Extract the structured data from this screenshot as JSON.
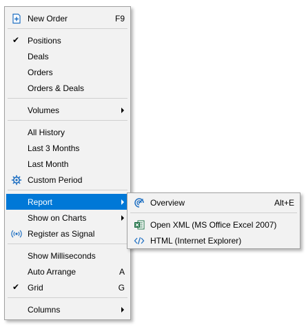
{
  "main_menu": {
    "new_order": {
      "label": "New Order",
      "shortcut": "F9",
      "icon": "new-order-icon"
    },
    "positions": {
      "label": "Positions",
      "checked": true
    },
    "deals": {
      "label": "Deals"
    },
    "orders": {
      "label": "Orders"
    },
    "orders_deals": {
      "label": "Orders & Deals"
    },
    "volumes": {
      "label": "Volumes",
      "submenu": true
    },
    "all_history": {
      "label": "All History"
    },
    "last_3_months": {
      "label": "Last 3 Months"
    },
    "last_month": {
      "label": "Last Month"
    },
    "custom_period": {
      "label": "Custom Period",
      "icon": "gear-icon"
    },
    "report": {
      "label": "Report",
      "submenu": true,
      "highlighted": true
    },
    "show_on_charts": {
      "label": "Show on Charts",
      "submenu": true
    },
    "register_signal": {
      "label": "Register as Signal",
      "icon": "signal-icon"
    },
    "show_milliseconds": {
      "label": "Show Milliseconds"
    },
    "auto_arrange": {
      "label": "Auto Arrange",
      "shortcut": "A"
    },
    "grid": {
      "label": "Grid",
      "shortcut": "G",
      "checked": true
    },
    "columns": {
      "label": "Columns",
      "submenu": true
    }
  },
  "report_submenu": {
    "overview": {
      "label": "Overview",
      "shortcut": "Alt+E",
      "icon": "overview-icon"
    },
    "open_xml": {
      "label": "Open XML (MS Office Excel 2007)",
      "icon": "excel-icon"
    },
    "html": {
      "label": "HTML (Internet Explorer)",
      "icon": "html-code-icon"
    }
  },
  "colors": {
    "highlight": "#0078d7",
    "menu_bg": "#f2f2f2",
    "icon_blue": "#1e6fc2",
    "excel_green": "#1e7145"
  },
  "check_glyph": "✔"
}
